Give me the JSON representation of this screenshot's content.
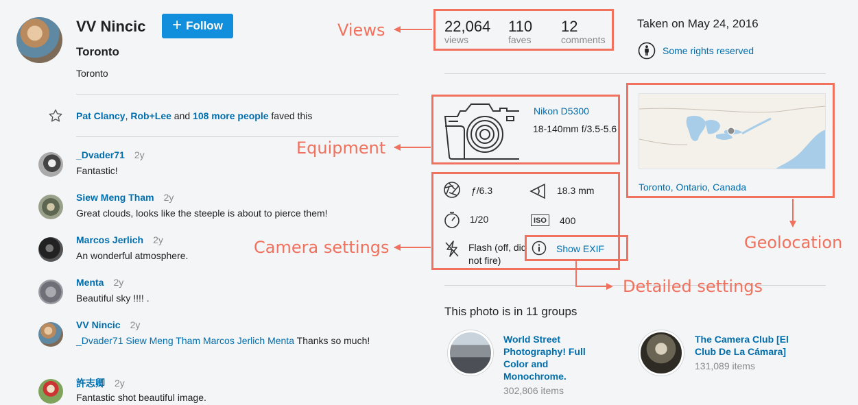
{
  "owner": {
    "name": "VV Nincic",
    "follow_label": "Follow",
    "location_bold": "Toronto",
    "location": "Toronto"
  },
  "faves": {
    "user1": "Pat Clancy",
    "sep": ",",
    "user2": "Rob+Lee",
    "and": "and",
    "more": "108 more people",
    "suffix": "faved this"
  },
  "comments": [
    {
      "name": "_Dvader71",
      "age": "2y",
      "text": "Fantastic!"
    },
    {
      "name": "Siew Meng Tham",
      "age": "2y",
      "text": "Great clouds, looks like the steeple is about to pierce them!"
    },
    {
      "name": "Marcos Jerlich",
      "age": "2y",
      "text": "An wonderful atmosphere."
    },
    {
      "name": "Menta",
      "age": "2y",
      "text": "Beautiful sky !!!! ."
    },
    {
      "name": "VV Nincic",
      "age": "2y",
      "mentions": "_Dvader71 Siew Meng Tham Marcos Jerlich Menta",
      "text": "Thanks so much!"
    },
    {
      "name": "許志卿",
      "age": "2y",
      "text": "Fantastic shot beautiful image."
    }
  ],
  "stats": {
    "views_num": "22,064",
    "views_label": "views",
    "faves_num": "110",
    "faves_label": "faves",
    "comments_num": "12",
    "comments_label": "comments"
  },
  "taken": "Taken on May 24, 2016",
  "rights": "Some rights reserved",
  "equipment": {
    "camera": "Nikon D5300",
    "lens": "18-140mm f/3.5-5.6"
  },
  "settings": {
    "aperture": "ƒ/6.3",
    "focal_length": "18.3 mm",
    "shutter": "1/20",
    "iso_label": "ISO",
    "iso": "400",
    "flash": "Flash (off, did not fire)",
    "exif": "Show EXIF"
  },
  "geo": {
    "location": "Toronto, Ontario, Canada"
  },
  "groups": {
    "title": "This photo is in 11 groups",
    "items": [
      {
        "name": "World Street Photography! Full Color and Monochrome.",
        "count": "302,806 items"
      },
      {
        "name": "The Camera Club [El Club De La Cámara]",
        "count": "131,089 items"
      }
    ]
  },
  "annotations": {
    "views": "Views",
    "equipment": "Equipment",
    "camera_settings": "Camera settings",
    "detailed_settings": "Detailed settings",
    "geolocation": "Geolocation",
    "color": "#f0715d"
  }
}
